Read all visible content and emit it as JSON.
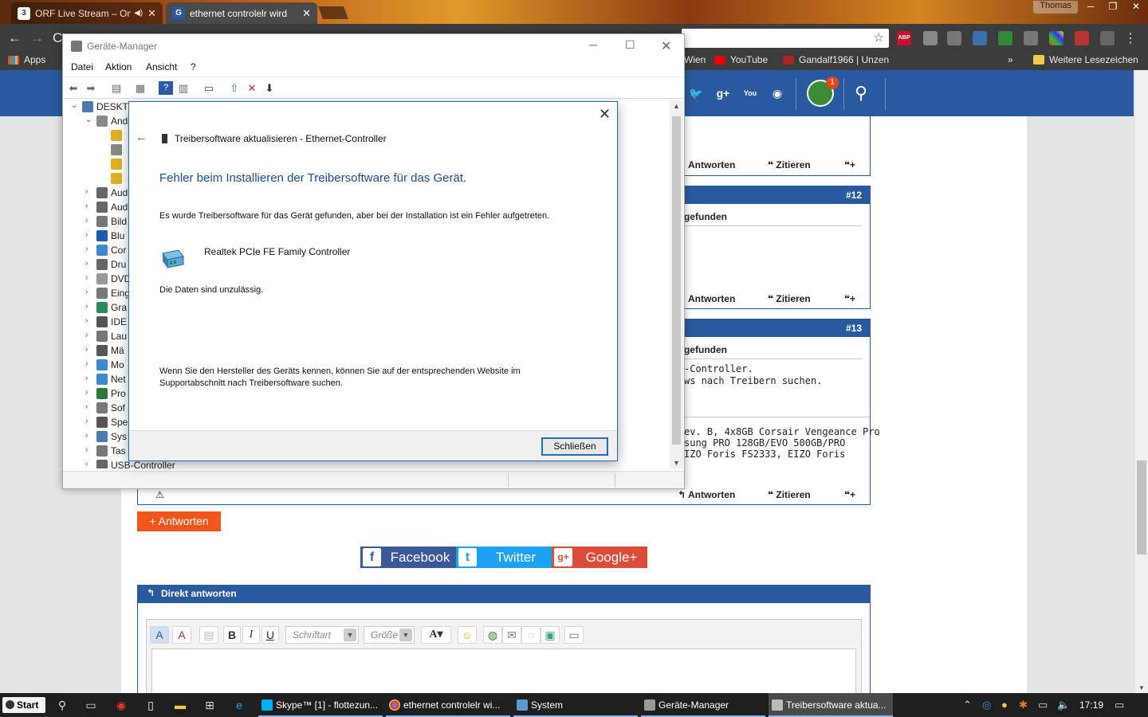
{
  "browser": {
    "tabs": [
      {
        "label": "ORF Live Stream – On",
        "favicon": "orf-favicon-icon"
      },
      {
        "label": "ethernet controlelr wird",
        "favicon": "forum-favicon-icon"
      }
    ],
    "user": "Thomas",
    "bookmarks": {
      "apps": "Apps",
      "items": [
        "Wien",
        "YouTube",
        "Gandalf1966 | Unzen"
      ],
      "more": "»",
      "other": "Weitere Lesezeichen"
    }
  },
  "site": {
    "notification_count": "1",
    "posts": [
      {
        "actions": {
          "answer": "Antworten",
          "quote": "Zitieren"
        }
      },
      {
        "number": "#12",
        "title": "gefunden",
        "actions": {
          "answer": "Antworten",
          "quote": "Zitieren"
        }
      },
      {
        "number": "#13",
        "title": "gefunden",
        "text": [
          "-Controller.",
          "ws nach Treibern suchen."
        ],
        "signature": [
          "ev. B, 4x8GB Corsair Vengeance Pro",
          "sung PRO 128GB/EVO 500GB/PRO",
          "IZO Foris FS2333, EIZO Foris"
        ],
        "actions": {
          "answer": "Antworten",
          "quote": "Zitieren"
        }
      }
    ],
    "reply_button": "+ Antworten",
    "share": {
      "facebook": "Facebook",
      "twitter": "Twitter",
      "googleplus": "Google+"
    },
    "direct_reply": {
      "title": "Direkt antworten",
      "font_placeholder": "Schriftart",
      "size_placeholder": "Größe"
    }
  },
  "device_manager": {
    "title": "Geräte-Manager",
    "menu": [
      "Datei",
      "Aktion",
      "Ansicht",
      "?"
    ],
    "tree": [
      {
        "label": "DESKTO",
        "level": 0,
        "icon": "computer-icon"
      },
      {
        "label": "And",
        "level": 1,
        "icon": "unknown-device-icon"
      },
      {
        "label": "",
        "level": 2,
        "icon": "warning-device-icon"
      },
      {
        "label": "",
        "level": 2,
        "icon": "unknown-device-icon"
      },
      {
        "label": "",
        "level": 2,
        "icon": "warning-device-icon"
      },
      {
        "label": "",
        "level": 2,
        "icon": "warning-device-icon"
      },
      {
        "label": "Aud",
        "level": 1,
        "icon": "speaker-icon"
      },
      {
        "label": "Aud",
        "level": 1,
        "icon": "speaker-icon"
      },
      {
        "label": "Bild",
        "level": 1,
        "icon": "camera-icon"
      },
      {
        "label": "Blu",
        "level": 1,
        "icon": "bluetooth-icon"
      },
      {
        "label": "Cor",
        "level": 1,
        "icon": "monitor-icon"
      },
      {
        "label": "Dru",
        "level": 1,
        "icon": "printer-icon"
      },
      {
        "label": "DVD",
        "level": 1,
        "icon": "disc-icon"
      },
      {
        "label": "Eing",
        "level": 1,
        "icon": "keyboard-icon"
      },
      {
        "label": "Gra",
        "level": 1,
        "icon": "display-adapter-icon"
      },
      {
        "label": "IDE",
        "level": 1,
        "icon": "ide-controller-icon"
      },
      {
        "label": "Lau",
        "level": 1,
        "icon": "drive-icon"
      },
      {
        "label": "Mä",
        "level": 1,
        "icon": "mouse-icon"
      },
      {
        "label": "Mo",
        "level": 1,
        "icon": "monitor-icon"
      },
      {
        "label": "Net",
        "level": 1,
        "icon": "network-icon"
      },
      {
        "label": "Pro",
        "level": 1,
        "icon": "processor-icon"
      },
      {
        "label": "Sof",
        "level": 1,
        "icon": "software-device-icon"
      },
      {
        "label": "Spe",
        "level": 1,
        "icon": "storage-controller-icon"
      },
      {
        "label": "Sys",
        "level": 1,
        "icon": "system-device-icon"
      },
      {
        "label": "Tas",
        "level": 1,
        "icon": "keyboard-icon"
      },
      {
        "label": "USB-Controller",
        "level": 1,
        "icon": "usb-icon"
      }
    ]
  },
  "dialog": {
    "page_title": "Treibersoftware aktualisieren - Ethernet-Controller",
    "heading": "Fehler beim Installieren der Treibersoftware für das Gerät.",
    "message": "Es wurde Treibersoftware für das Gerät gefunden, aber bei der Installation ist ein Fehler aufgetreten.",
    "device": "Realtek PCIe FE Family Controller",
    "error": "Die Daten sind unzulässig.",
    "hint": "Wenn Sie den Hersteller des Geräts kennen, können Sie auf der entsprechenden Website im Supportabschnitt nach Treibersoftware suchen.",
    "close_button": "Schließen"
  },
  "taskbar": {
    "start": "Start",
    "tasks": [
      {
        "label": "Skype™ [1] - flottezun...",
        "icon": "skype-icon"
      },
      {
        "label": "ethernet controlelr wi...",
        "icon": "chrome-icon"
      },
      {
        "label": "System",
        "icon": "system-icon"
      },
      {
        "label": "Geräte-Manager",
        "icon": "device-manager-icon"
      },
      {
        "label": "Treibersoftware aktua...",
        "icon": "driver-icon"
      }
    ],
    "clock": "17:19"
  }
}
